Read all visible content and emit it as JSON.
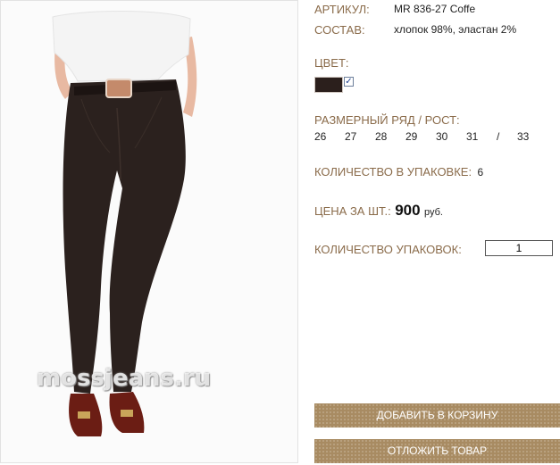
{
  "product": {
    "watermark": "mossjeans.ru",
    "article_label": "АРТИКУЛ:",
    "article_value": "MR 836-27 Coffe",
    "composition_label": "СОСТАВ:",
    "composition_value": "хлопок 98%, эластан 2%",
    "color_label": "ЦВЕТ:",
    "color_swatch": "#2b1f1c",
    "color_checked_mark": "✓",
    "size_label": "РАЗМЕРНЫЙ РЯД / РОСТ:",
    "sizes": [
      "26",
      "27",
      "28",
      "29",
      "30",
      "31",
      "/",
      "33"
    ],
    "pack_label": "КОЛИЧЕСТВО В УПАКОВКЕ:",
    "pack_value": "6",
    "price_label": "ЦЕНА ЗА ШТ.:",
    "price_value": "900",
    "price_currency": "руб.",
    "qty_label": "КОЛИЧЕСТВО УПАКОВОК:",
    "qty_value": "1"
  },
  "actions": {
    "add_to_cart": "ДОБАВИТЬ В КОРЗИНУ",
    "postpone": "ОТЛОЖИТЬ ТОВАР"
  },
  "colors": {
    "label": "#8a6b4a",
    "button": "#a88b62",
    "jeans": "#2b211e"
  }
}
